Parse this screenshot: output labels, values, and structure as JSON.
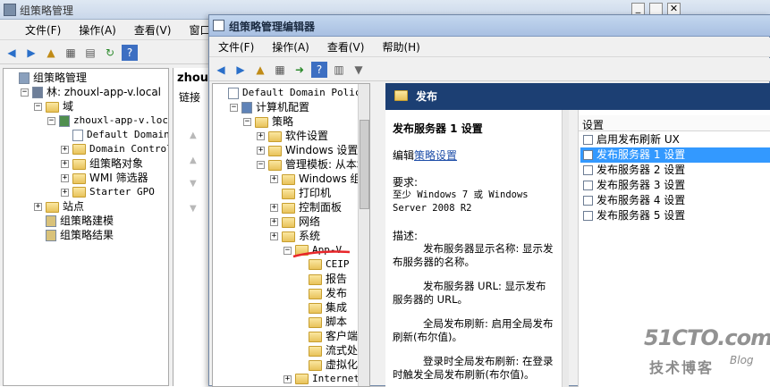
{
  "back_window": {
    "title": "组策略管理",
    "menu": [
      "文件(F)",
      "操作(A)",
      "查看(V)",
      "窗口(W)"
    ],
    "tree": [
      {
        "label": "组策略管理",
        "depth": 0,
        "icon": "gpm-icon",
        "expander": ""
      },
      {
        "label": "林: zhouxl-app-v.local",
        "depth": 1,
        "icon": "forest-icon",
        "expander": "−"
      },
      {
        "label": "域",
        "depth": 2,
        "icon": "folder-icon",
        "expander": "−"
      },
      {
        "label": "zhouxl-app-v.loca",
        "depth": 3,
        "icon": "domain-icon",
        "expander": "−"
      },
      {
        "label": "Default Domain",
        "depth": 4,
        "icon": "gpo-icon",
        "expander": ""
      },
      {
        "label": "Domain Control",
        "depth": 4,
        "icon": "folder-icon",
        "expander": "+"
      },
      {
        "label": "组策略对象",
        "depth": 4,
        "icon": "folder-icon",
        "expander": "+"
      },
      {
        "label": "WMI 筛选器",
        "depth": 4,
        "icon": "folder-icon",
        "expander": "+"
      },
      {
        "label": "Starter GPO",
        "depth": 4,
        "icon": "folder-icon",
        "expander": "+"
      },
      {
        "label": "站点",
        "depth": 2,
        "icon": "folder-icon",
        "expander": "+"
      },
      {
        "label": "组策略建模",
        "depth": 2,
        "icon": "modeling-icon",
        "expander": ""
      },
      {
        "label": "组策略结果",
        "depth": 2,
        "icon": "results-icon",
        "expander": ""
      }
    ],
    "right_title": "zhou",
    "right_sub": "链接"
  },
  "front_window": {
    "title": "组策略管理编辑器",
    "menu": [
      "文件(F)",
      "操作(A)",
      "查看(V)",
      "帮助(H)"
    ],
    "tree": [
      {
        "label": "Default Domain Policy [TE",
        "depth": 0,
        "icon": "gpo-icon",
        "expander": ""
      },
      {
        "label": "计算机配置",
        "depth": 1,
        "icon": "computer-icon",
        "expander": "−"
      },
      {
        "label": "策略",
        "depth": 2,
        "icon": "folder-icon",
        "expander": "−"
      },
      {
        "label": "软件设置",
        "depth": 3,
        "icon": "folder-icon",
        "expander": "+"
      },
      {
        "label": "Windows 设置",
        "depth": 3,
        "icon": "folder-icon",
        "expander": "+"
      },
      {
        "label": "管理模板: 从本地",
        "depth": 3,
        "icon": "folder-icon",
        "expander": "−"
      },
      {
        "label": "Windows 组件",
        "depth": 4,
        "icon": "folder-icon",
        "expander": "+"
      },
      {
        "label": "打印机",
        "depth": 4,
        "icon": "folder-icon",
        "expander": ""
      },
      {
        "label": "控制面板",
        "depth": 4,
        "icon": "folder-icon",
        "expander": "+"
      },
      {
        "label": "网络",
        "depth": 4,
        "icon": "folder-icon",
        "expander": "+"
      },
      {
        "label": "系统",
        "depth": 4,
        "icon": "folder-icon",
        "expander": "+"
      },
      {
        "label": "App-V",
        "depth": 5,
        "icon": "folder-icon",
        "expander": "−"
      },
      {
        "label": "CEIP",
        "depth": 6,
        "icon": "folder-icon",
        "expander": ""
      },
      {
        "label": "报告",
        "depth": 6,
        "icon": "folder-icon",
        "expander": ""
      },
      {
        "label": "发布",
        "depth": 6,
        "icon": "folder-icon",
        "expander": ""
      },
      {
        "label": "集成",
        "depth": 6,
        "icon": "folder-icon",
        "expander": ""
      },
      {
        "label": "脚本",
        "depth": 6,
        "icon": "folder-icon",
        "expander": ""
      },
      {
        "label": "客户端",
        "depth": 6,
        "icon": "folder-icon",
        "expander": ""
      },
      {
        "label": "流式处",
        "depth": 6,
        "icon": "folder-icon",
        "expander": ""
      },
      {
        "label": "虚拟化",
        "depth": 6,
        "icon": "folder-icon",
        "expander": ""
      },
      {
        "label": "Internet",
        "depth": 5,
        "icon": "folder-icon",
        "expander": "+"
      }
    ],
    "header_title": "发布",
    "detail": {
      "title": "发布服务器 1 设置",
      "edit_prefix": "编辑",
      "edit_link": "策略设置",
      "requirements_label": "要求:",
      "requirements": "至少 Windows 7 或 Windows Server 2008 R2",
      "description_label": "描述:",
      "paragraphs": [
        "发布服务器显示名称: 显示发布服务器的名称。",
        "发布服务器 URL: 显示发布服务器的 URL。",
        "全局发布刷新: 启用全局发布刷新(布尔值)。",
        "登录时全局发布刷新: 在登录时触发全局发布刷新(布尔值)。"
      ]
    },
    "settings_header": "设置",
    "settings": [
      {
        "label": "启用发布刷新 UX",
        "selected": false
      },
      {
        "label": "发布服务器 1 设置",
        "selected": true
      },
      {
        "label": "发布服务器 2 设置",
        "selected": false
      },
      {
        "label": "发布服务器 3 设置",
        "selected": false
      },
      {
        "label": "发布服务器 4 设置",
        "selected": false
      },
      {
        "label": "发布服务器 5 设置",
        "selected": false
      }
    ]
  },
  "watermark": {
    "main": "51CTO.com",
    "sub": "技术博客",
    "blog": "Blog"
  }
}
